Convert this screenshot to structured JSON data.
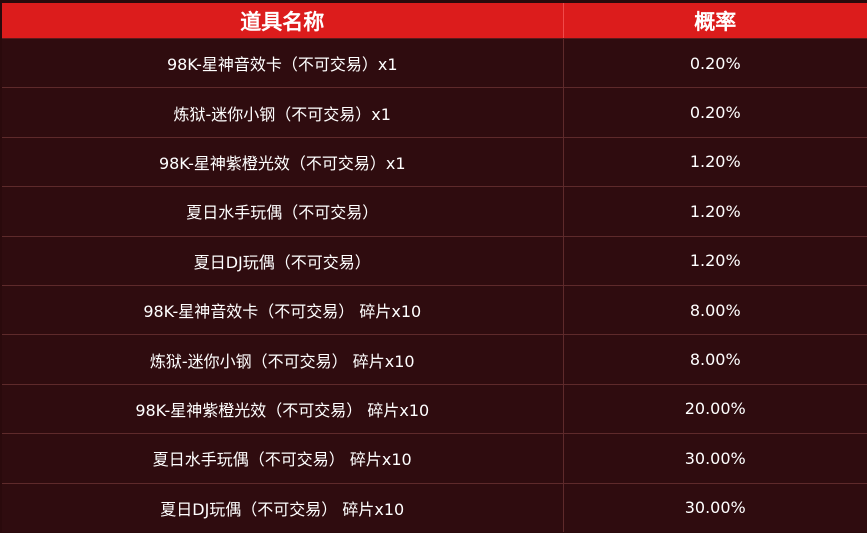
{
  "table": {
    "headers": [
      "道具名称",
      "概率"
    ],
    "rows": [
      {
        "item": "98K-星神音效卡（不可交易）x1",
        "prob": "0.20%"
      },
      {
        "item": "炼狱-迷你小钢（不可交易）x1",
        "prob": "0.20%"
      },
      {
        "item": "98K-星神紫橙光效（不可交易）x1",
        "prob": "1.20%"
      },
      {
        "item": "夏日水手玩偶（不可交易）",
        "prob": "1.20%"
      },
      {
        "item": "夏日DJ玩偶（不可交易）",
        "prob": "1.20%"
      },
      {
        "item": "98K-星神音效卡（不可交易） 碎片x10",
        "prob": "8.00%"
      },
      {
        "item": "炼狱-迷你小钢（不可交易） 碎片x10",
        "prob": "8.00%"
      },
      {
        "item": "98K-星神紫橙光效（不可交易） 碎片x10",
        "prob": "20.00%"
      },
      {
        "item": "夏日水手玩偶（不可交易） 碎片x10",
        "prob": "30.00%"
      },
      {
        "item": "夏日DJ玩偶（不可交易） 碎片x10",
        "prob": "30.00%"
      }
    ]
  },
  "colors": {
    "header_bg": "#dc1c1c",
    "body_bg": "#2f0c0f",
    "text": "#ffffff"
  }
}
